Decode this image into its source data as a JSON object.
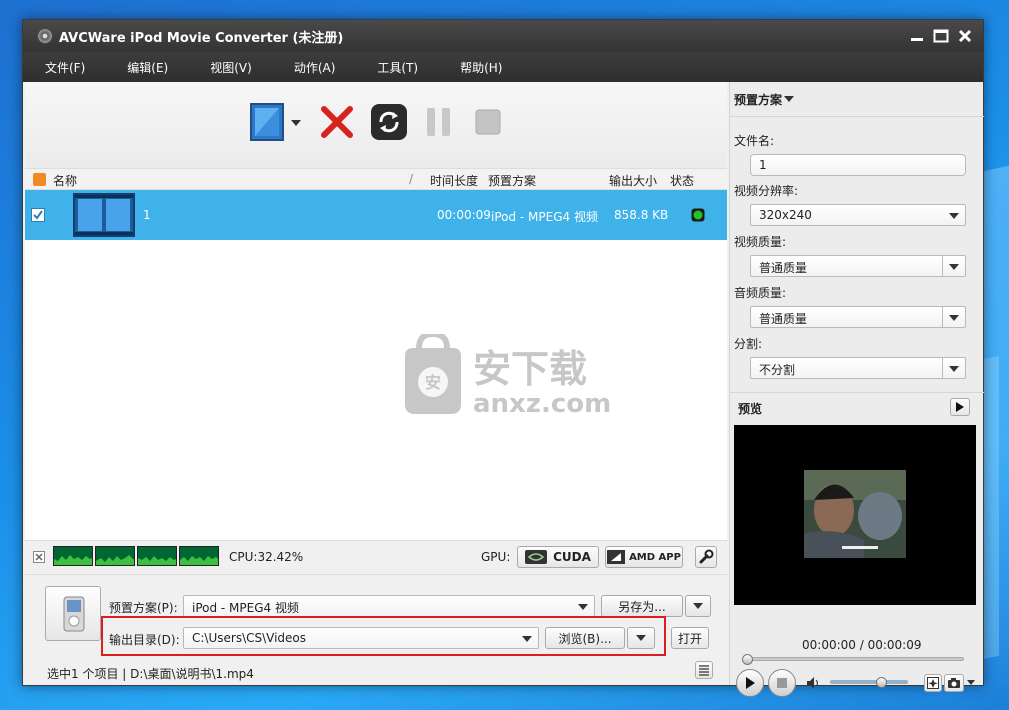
{
  "window": {
    "title": "AVCWare iPod Movie Converter (未注册)",
    "controls": [
      "minimize",
      "maximize",
      "close"
    ]
  },
  "menu": [
    "文件(F)",
    "编辑(E)",
    "视图(V)",
    "动作(A)",
    "工具(T)",
    "帮助(H)"
  ],
  "toolbar": {
    "icons": [
      "add-video-icon",
      "delete-icon",
      "convert-icon",
      "pause-icon",
      "stop-icon"
    ]
  },
  "list": {
    "columns": [
      "名称",
      "时间长度",
      "预置方案",
      "输出大小",
      "状态"
    ],
    "sort_mark": "/",
    "rows": [
      {
        "name": "1",
        "duration": "00:00:09",
        "profile": "iPod - MPEG4 视频",
        "size": "858.8 KB",
        "status_color": "#22c322",
        "checked": true
      }
    ]
  },
  "watermark": {
    "cn": "安下载",
    "en": "anxz.com",
    "badge": "安"
  },
  "status_strip": {
    "cpu": "CPU:32.42%",
    "gpu_label": "GPU:",
    "cuda": "CUDA",
    "amd": "AMD APP"
  },
  "bottom": {
    "profile_label": "预置方案(P):",
    "profile_value": "iPod - MPEG4 视频",
    "save_as": "另存为...",
    "output_label": "输出目录(D):",
    "output_value": "C:\\Users\\CS\\Videos",
    "browse": "浏览(B)...",
    "open": "打开",
    "status_text": "选中1 个项目 | D:\\桌面\\说明书\\1.mp4"
  },
  "right_panel": {
    "header": "预置方案",
    "filename_label": "文件名:",
    "filename_value": "1",
    "resolution_label": "视频分辨率:",
    "resolution_value": "320x240",
    "video_quality_label": "视频质量:",
    "video_quality_value": "普通质量",
    "audio_quality_label": "音频质量:",
    "audio_quality_value": "普通质量",
    "split_label": "分割:",
    "split_value": "不分割",
    "preview_label": "预览",
    "time_display": "00:00:00 / 00:00:09",
    "playback_progress": 0,
    "volume_level": 0.7
  },
  "colors": {
    "selection": "#3fb2ea",
    "highlight_box": "#d9201f",
    "checkbox": "#f08a24"
  }
}
